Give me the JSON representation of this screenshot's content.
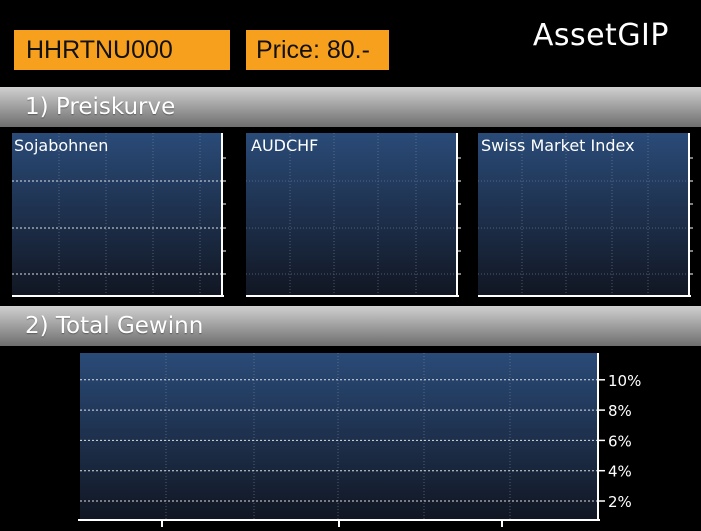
{
  "header": {
    "asset_code": "HHRTNU000",
    "price_label": "Price: 80.-",
    "brand": "AssetGIP"
  },
  "sections": {
    "price_curve_title": "1) Preiskurve",
    "total_gain_title": "2) Total Gewinn"
  },
  "colors": {
    "badge": "#f7a01e",
    "plot_top": "#2a4b78",
    "plot_bottom": "#111622"
  },
  "price_charts": [
    {
      "title": "Sojabohnen"
    },
    {
      "title": "AUDCHF"
    },
    {
      "title": "Swiss Market Index"
    }
  ],
  "chart_data": [
    {
      "type": "line",
      "title": "Sojabohnen",
      "series": []
    },
    {
      "type": "line",
      "title": "AUDCHF",
      "series": []
    },
    {
      "type": "line",
      "title": "Swiss Market Index",
      "series": []
    },
    {
      "type": "bar",
      "title": "",
      "categories": [],
      "series": [],
      "ytick_labels": [
        "10%",
        "8%",
        "6%",
        "4%",
        "2%"
      ],
      "yticks": [
        10,
        8,
        6,
        4,
        2
      ],
      "ylim": [
        0,
        10
      ],
      "grid": true
    }
  ]
}
